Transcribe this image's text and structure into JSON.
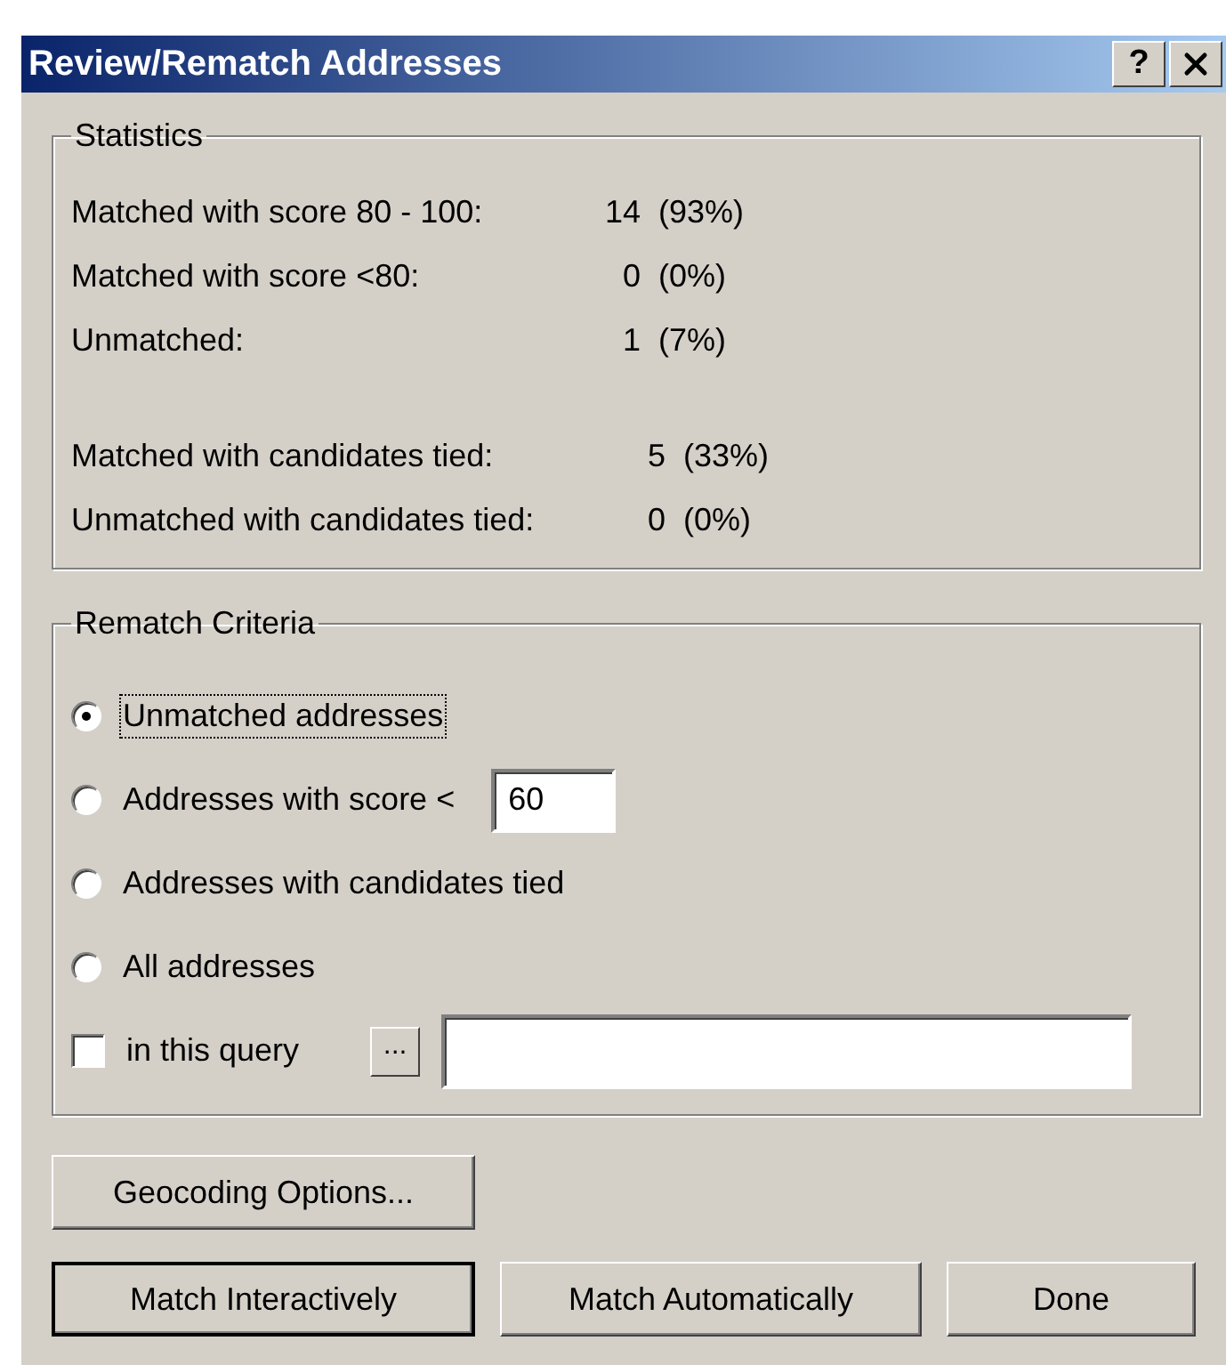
{
  "window": {
    "title": "Review/Rematch Addresses",
    "help_label": "?"
  },
  "statistics": {
    "title": "Statistics",
    "groups": [
      {
        "rows": [
          {
            "label": "Matched with score 80 - 100:",
            "count": "14",
            "percent": "(93%)"
          },
          {
            "label": "Matched with score <80:",
            "count": "0",
            "percent": "(0%)"
          },
          {
            "label": "Unmatched:",
            "count": "1",
            "percent": "(7%)"
          }
        ]
      },
      {
        "rows": [
          {
            "label": "Matched with candidates tied:",
            "count": "5",
            "percent": "(33%)"
          },
          {
            "label": "Unmatched with candidates tied:",
            "count": "0",
            "percent": "(0%)"
          }
        ]
      }
    ]
  },
  "rematch": {
    "title": "Rematch Criteria",
    "options": [
      {
        "kind": "radio",
        "label": "Unmatched addresses",
        "selected": true,
        "focused": true
      },
      {
        "kind": "radio",
        "label": "Addresses with score <",
        "selected": false,
        "focused": false,
        "value": "60"
      },
      {
        "kind": "radio",
        "label": "Addresses with candidates tied",
        "selected": false,
        "focused": false
      },
      {
        "kind": "radio",
        "label": "All addresses",
        "selected": false,
        "focused": false
      },
      {
        "kind": "checkbox",
        "label": "in this query",
        "checked": false,
        "focused": false,
        "browse_label": "..."
      }
    ]
  },
  "button_rows": [
    [
      {
        "label": "Geocoding Options...",
        "default": false
      }
    ],
    [
      {
        "label": "Match Interactively",
        "default": true
      },
      {
        "label": "Match Automatically",
        "default": false
      },
      {
        "label": "Done",
        "default": false
      }
    ]
  ]
}
